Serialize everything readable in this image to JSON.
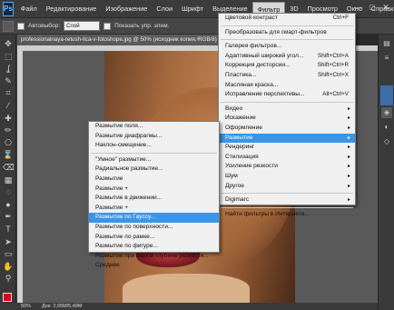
{
  "app": {
    "logo": "Ps",
    "menus": [
      "Файл",
      "Редактирование",
      "Изображение",
      "Слои",
      "Шрифт",
      "Выделение",
      "Фильтр",
      "3D",
      "Просмотр",
      "Окно",
      "Справка"
    ],
    "active_menu": "Фильтр",
    "window_controls": [
      "—",
      "□",
      "✕"
    ]
  },
  "options": {
    "autoselect_label": "Автовыбор:",
    "autoselect_value": "Слой",
    "show_controls_label": "Показать упр. элем."
  },
  "document": {
    "tab_title": "professionalnaya-retush-lica-v-fotoshope.jpg @ 50% (исходник копия, RGB/8)",
    "close": "×"
  },
  "status": {
    "zoom": "50%",
    "doc_size": "Док: 2,95M/5,49M"
  },
  "filter_menu": {
    "sections": [
      [
        {
          "label": "Цветовой контраст",
          "shortcut": "Ctrl+F"
        }
      ],
      [
        {
          "label": "Преобразовать для смарт-фильтров"
        }
      ],
      [
        {
          "label": "Галерея фильтров..."
        },
        {
          "label": "Адаптивный широкий угол...",
          "shortcut": "Shift+Ctrl+A"
        },
        {
          "label": "Коррекция дисторсии...",
          "shortcut": "Shift+Ctrl+R"
        },
        {
          "label": "Пластика...",
          "shortcut": "Shift+Ctrl+X"
        },
        {
          "label": "Масляная краска..."
        },
        {
          "label": "Исправление перспективы...",
          "shortcut": "Alt+Ctrl+V"
        }
      ],
      [
        {
          "label": "Видео",
          "submenu": true
        },
        {
          "label": "Искажение",
          "submenu": true
        },
        {
          "label": "Оформление",
          "submenu": true
        },
        {
          "label": "Размытие",
          "submenu": true,
          "highlighted": true
        },
        {
          "label": "Рендеринг",
          "submenu": true
        },
        {
          "label": "Стилизация",
          "submenu": true
        },
        {
          "label": "Усиление резкости",
          "submenu": true
        },
        {
          "label": "Шум",
          "submenu": true
        },
        {
          "label": "Другое",
          "submenu": true
        }
      ],
      [
        {
          "label": "Digimarc",
          "submenu": true
        }
      ],
      [
        {
          "label": "Найти фильтры в Интернете..."
        }
      ]
    ]
  },
  "blur_menu": {
    "sections": [
      [
        {
          "label": "Размытие поля..."
        },
        {
          "label": "Размытие диафрагмы..."
        },
        {
          "label": "Наклон-смещение..."
        }
      ],
      [
        {
          "label": "\"Умное\" размытие..."
        },
        {
          "label": "Радиальное размытие..."
        },
        {
          "label": "Размытие"
        },
        {
          "label": "Размытие +"
        },
        {
          "label": "Размытие в движении..."
        },
        {
          "label": "Размытие +"
        },
        {
          "label": "Размытие по Гауссу...",
          "highlighted": true
        },
        {
          "label": "Размытие по поверхности..."
        },
        {
          "label": "Размытие по рамке..."
        },
        {
          "label": "Размытие по фигуре..."
        },
        {
          "label": "Размытие при малой глубине резкости..."
        },
        {
          "label": "Среднее"
        }
      ]
    ]
  },
  "colors": {
    "highlight": "#3a95e8",
    "foreground_swatch": "#e0001a"
  },
  "icons": {
    "arrow": "▸",
    "tools": [
      "move-icon",
      "marquee-icon",
      "lasso-icon",
      "quick-select-icon",
      "crop-icon",
      "eyedropper-icon",
      "healing-icon",
      "brush-icon",
      "clone-stamp-icon",
      "history-brush-icon",
      "eraser-icon",
      "gradient-icon",
      "blur-tool-icon",
      "dodge-icon",
      "pen-icon",
      "type-icon",
      "path-select-icon",
      "shape-icon",
      "hand-icon",
      "zoom-icon"
    ]
  }
}
